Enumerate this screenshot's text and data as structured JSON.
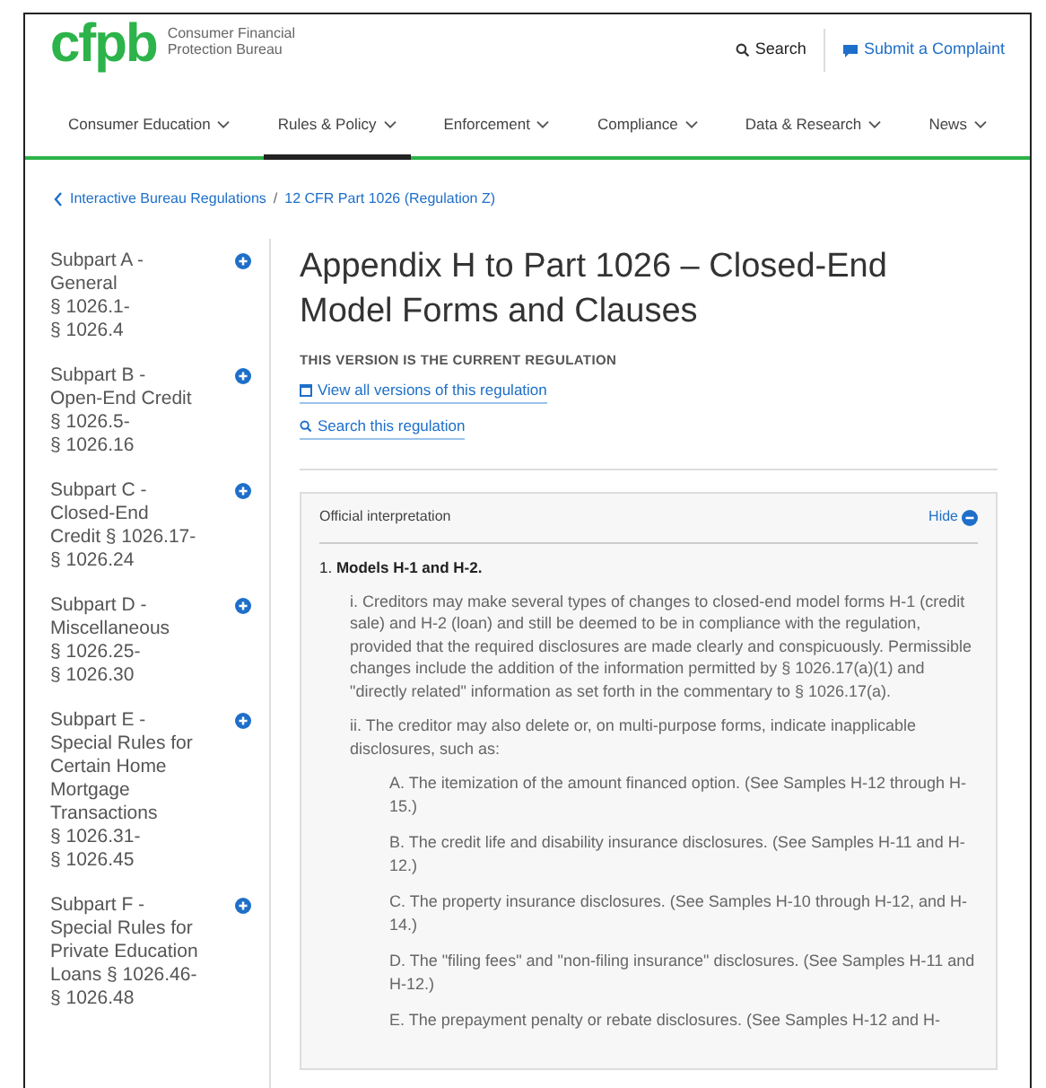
{
  "header": {
    "logo": "cfpb",
    "org_name": "Consumer Financial Protection Bureau",
    "search": "Search",
    "complaint": "Submit a Complaint"
  },
  "nav": [
    {
      "label": "Consumer Education",
      "selected": false
    },
    {
      "label": "Rules & Policy",
      "selected": true
    },
    {
      "label": "Enforcement",
      "selected": false
    },
    {
      "label": "Compliance",
      "selected": false
    },
    {
      "label": "Data & Research",
      "selected": false
    },
    {
      "label": "News",
      "selected": false
    }
  ],
  "breadcrumb_separator": "/",
  "breadcrumb": [
    "Interactive Bureau Regulations",
    "12 CFR Part 1026 (Regulation Z)"
  ],
  "sidebar": {
    "items": [
      {
        "lines": [
          "Subpart A -",
          "General",
          "§ 1026.1-",
          "§ 1026.4"
        ]
      },
      {
        "lines": [
          "Subpart B -",
          "Open-End Credit",
          "§ 1026.5-",
          "§ 1026.16"
        ]
      },
      {
        "lines": [
          "Subpart C -",
          "Closed-End",
          "Credit § 1026.17-",
          "§ 1026.24"
        ]
      },
      {
        "lines": [
          "Subpart D -",
          "Miscellaneous",
          "§ 1026.25-",
          "§ 1026.30"
        ]
      },
      {
        "lines": [
          "Subpart E -",
          "Special Rules for",
          "Certain Home",
          "Mortgage",
          "Transactions",
          "§ 1026.31-",
          "§ 1026.45"
        ]
      },
      {
        "lines": [
          "Subpart F -",
          "Special Rules for",
          "Private Education",
          "Loans § 1026.46-",
          "§ 1026.48"
        ]
      }
    ]
  },
  "main": {
    "title": "Appendix H to Part 1026 – Closed-End Model Forms and Clauses",
    "version_note": "THIS VERSION IS THE CURRENT REGULATION",
    "links": [
      {
        "kind": "calendar",
        "label": "View all versions of this regulation"
      },
      {
        "kind": "search",
        "label": "Search this regulation"
      }
    ]
  },
  "interpretation": {
    "heading": "Official interpretation",
    "toggle": "Hide",
    "expanded": true,
    "title": "1. **Models H-1 and H-2.**",
    "paragraphs": [
      "i. Creditors may make several types of changes to closed-end model forms H-1 (credit sale) and H-2 (loan) and still be deemed to be in compliance with the regulation, provided that the required disclosures are made clearly and conspicuously. Permissible changes include the addition of the information permitted by § 1026.17(a)(1) and \"directly related\" information as set forth in the commentary to § 1026.17(a).",
      "ii. The creditor may also delete or, on multi-purpose forms, indicate inapplicable disclosures, such as:"
    ],
    "items": [
      "A. The itemization of the amount financed option. (See Samples H-12 through H-15.)",
      "B. The credit life and disability insurance disclosures. (See Samples H-11 and H-12.)",
      "C. The property insurance disclosures. (See Samples H-10 through H-12, and H-14.)",
      "D. The \"filing fees\" and \"non-filing insurance\" disclosures. (See Samples H-11 and H-12.)",
      "E. The prepayment penalty or rebate disclosures. (See Samples H-12 and H-"
    ]
  }
}
